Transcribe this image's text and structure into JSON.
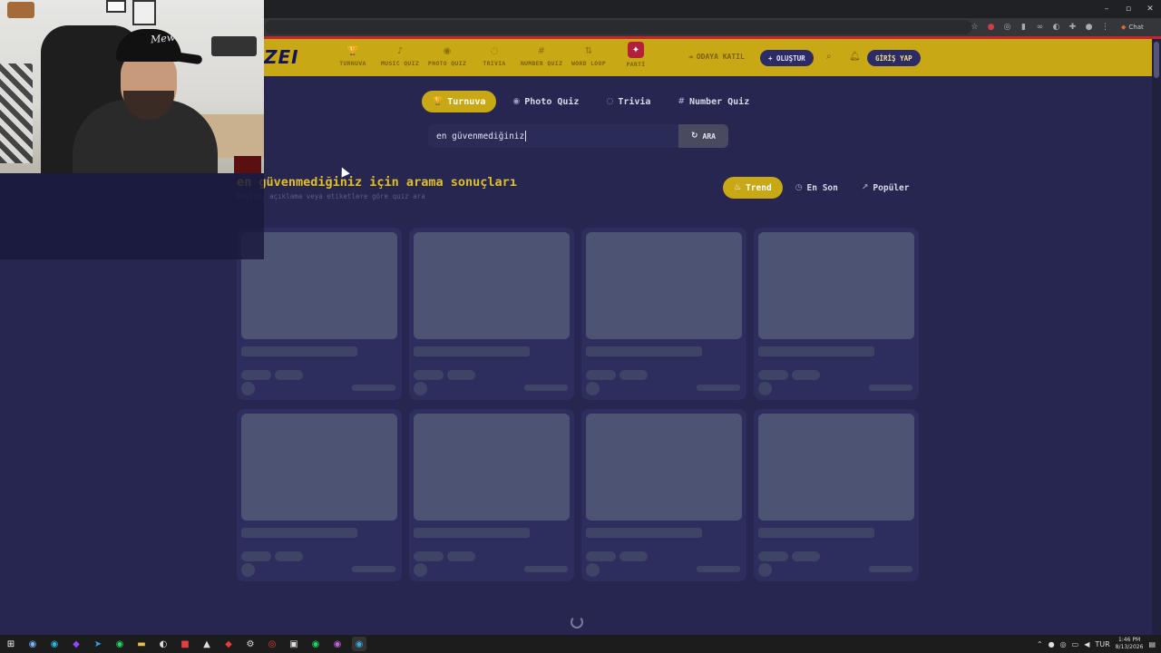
{
  "browser": {
    "window_controls": [
      "–",
      "▫",
      "✕"
    ],
    "chat_label": "Chat"
  },
  "nav": {
    "logo": "ZEI",
    "items": [
      {
        "label": "TURNUVA",
        "icon": "trophy-icon",
        "glyph": "🏆"
      },
      {
        "label": "MUSIC QUIZ",
        "icon": "music-note-icon",
        "glyph": "♪"
      },
      {
        "label": "PHOTO QUIZ",
        "icon": "camera-icon",
        "glyph": "◉"
      },
      {
        "label": "TRIVIA",
        "icon": "chat-bubble-icon",
        "glyph": "◌"
      },
      {
        "label": "NUMBER QUIZ",
        "icon": "hash-icon",
        "glyph": "#"
      },
      {
        "label": "WORD LOOP",
        "icon": "arrows-icon",
        "glyph": "⇅"
      },
      {
        "label": "PARTİ",
        "icon": "party-icon",
        "glyph": "✦"
      }
    ],
    "join_label": "ODAYA KATIL",
    "create_label": "+ OLUŞTUR",
    "login_label": "GİRİŞ YAP"
  },
  "tabs": [
    {
      "label": "Turnuva",
      "glyph": "🏆",
      "active": true
    },
    {
      "label": "Photo Quiz",
      "glyph": "◉",
      "active": false
    },
    {
      "label": "Trivia",
      "glyph": "◌",
      "active": false
    },
    {
      "label": "Number Quiz",
      "glyph": "#",
      "active": false
    }
  ],
  "search": {
    "value": "en güvenmediğiniz",
    "button_label": "ARA",
    "button_glyph": "↻"
  },
  "results": {
    "title": "en güvenmediğiniz için arama sonuçları",
    "subtitle": "Başlık, açıklama veya etiketlere göre quiz ara"
  },
  "sort": [
    {
      "label": "Trend",
      "glyph": "♨",
      "active": true
    },
    {
      "label": "En Son",
      "glyph": "◷",
      "active": false
    },
    {
      "label": "Popüler",
      "glyph": "↗",
      "active": false
    }
  ],
  "webcam": {
    "cap_text": "Mew"
  },
  "taskbar": {
    "clock_time": "1:46 PM",
    "clock_date": "8/13/2026",
    "lang": "TUR"
  }
}
